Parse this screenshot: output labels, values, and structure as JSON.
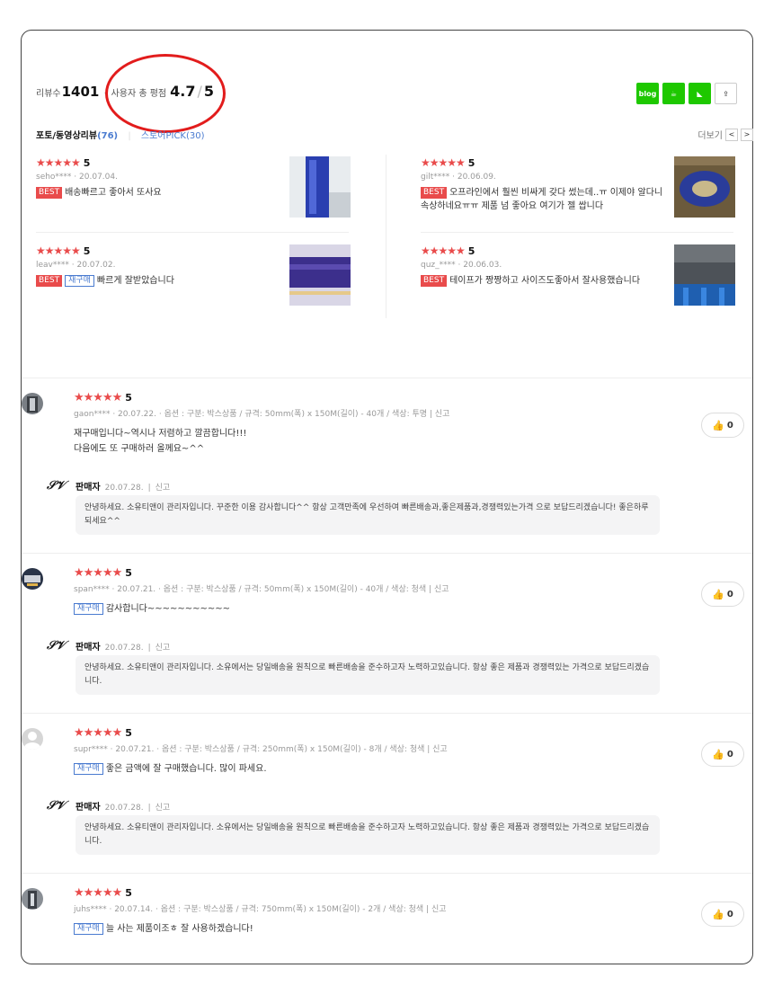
{
  "summary": {
    "review_count_label": "리뷰수",
    "review_count": "1401",
    "rating_label": "사용자 총 평점",
    "rating": "4.7",
    "rating_max": "5"
  },
  "share": {
    "blog": "blog",
    "cafe": "☕",
    "band": "◣",
    "share": "⇪"
  },
  "tabs": {
    "photo_label": "포토/동영상리뷰",
    "photo_count": "(76)",
    "store_label": "스토어PICK",
    "store_count": "(30)",
    "more": "더보기",
    "prev": "<",
    "next": ">"
  },
  "photo_reviews": [
    {
      "stars": "★★★★★",
      "rating": "5",
      "user": "seho****",
      "date": "20.07.04.",
      "badges": [
        "BEST"
      ],
      "text": "배송빠르고 좋아서 또사요"
    },
    {
      "stars": "★★★★★",
      "rating": "5",
      "user": "gilt****",
      "date": "20.06.09.",
      "badges": [
        "BEST"
      ],
      "text": "오프라인에서 훨씬 비싸게 갖다 썼는데..ㅠ 이제야 알다니 속상하네요ㅠㅠ 제품 넘 좋아요 여기가 젤 쌉니다"
    },
    {
      "stars": "★★★★★",
      "rating": "5",
      "user": "leav****",
      "date": "20.07.02.",
      "badges": [
        "BEST",
        "재구매"
      ],
      "text": "빠르게 잘받았습니다"
    },
    {
      "stars": "★★★★★",
      "rating": "5",
      "user": "quz_****",
      "date": "20.06.03.",
      "badges": [
        "BEST"
      ],
      "text": "테이프가 짱짱하고 사이즈도좋아서 잘사용했습니다"
    }
  ],
  "reviews": [
    {
      "stars": "★★★★★",
      "rating": "5",
      "user": "gaon****",
      "date": "20.07.22.",
      "option": "옵션 : 구분: 박스상품 / 규격: 50mm(폭) x 150M(길이) - 40개 / 색상: 투명",
      "report": "신고",
      "rebuy": "",
      "text_1": "재구매입니다~역시나 저렴하고 깔끔합니다!!!",
      "text_2": "다음에도 또 구매하러 올께요~^^",
      "likes": "0",
      "seller_label": "판매자",
      "seller_date": "20.07.28.",
      "seller_report": "신고",
      "seller_reply": "안녕하세요. 소유티앤이 관리자입니다. 꾸준한 이용 감사합니다^^ 항상 고객만족에 우선하여 빠른배송과,좋은제품과,경쟁력있는가격 으로 보답드리겠습니다! 좋은하루 되세요^^"
    },
    {
      "stars": "★★★★★",
      "rating": "5",
      "user": "span****",
      "date": "20.07.21.",
      "option": "옵션 : 구분: 박스상품 / 규격: 50mm(폭) x 150M(길이) - 40개 / 색상: 청색",
      "report": "신고",
      "rebuy": "재구매",
      "text_1": "감사합니다~~~~~~~~~~~",
      "text_2": "",
      "likes": "0",
      "seller_label": "판매자",
      "seller_date": "20.07.28.",
      "seller_report": "신고",
      "seller_reply": "안녕하세요. 소유티앤이 관리자입니다. 소유에서는 당일배송을 원칙으로 빠른배송을 준수하고자 노력하고있습니다. 항상 좋은 제품과 경쟁력있는 가격으로 보답드리겠습니다."
    },
    {
      "stars": "★★★★★",
      "rating": "5",
      "user": "supr****",
      "date": "20.07.21.",
      "option": "옵션 : 구분: 박스상품 / 규격: 250mm(폭) x 150M(길이) - 8개 / 색상: 청색",
      "report": "신고",
      "rebuy": "재구매",
      "text_1": "좋은 금액에 잘 구매했습니다. 많이 파세요.",
      "text_2": "",
      "likes": "0",
      "seller_label": "판매자",
      "seller_date": "20.07.28.",
      "seller_report": "신고",
      "seller_reply": "안녕하세요. 소유티앤이 관리자입니다. 소유에서는 당일배송을 원칙으로 빠른배송을 준수하고자 노력하고있습니다. 항상 좋은 제품과 경쟁력있는 가격으로 보답드리겠습니다."
    },
    {
      "stars": "★★★★★",
      "rating": "5",
      "user": "juhs****",
      "date": "20.07.14.",
      "option": "옵션 : 구분: 박스상품 / 규격: 750mm(폭) x 150M(길이) - 2개 / 색상: 청색",
      "report": "신고",
      "rebuy": "재구매",
      "text_1": "늘 사는 제품이조ㅎ 잘 사용하겠습니다!",
      "text_2": "",
      "likes": "0"
    }
  ],
  "colors": {
    "star": "#e94b4b",
    "accent_blue": "#4a7bd0",
    "best_badge": "#e94b4b",
    "share_green": "#1ec800",
    "highlight_circle": "#e21c1c"
  }
}
